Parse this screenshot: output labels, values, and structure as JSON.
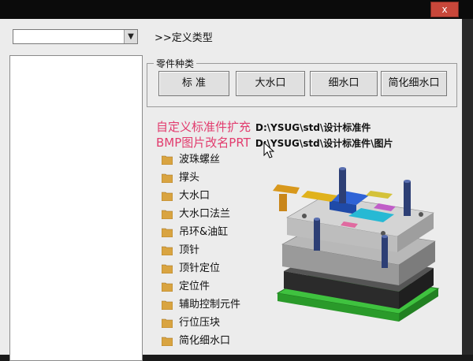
{
  "window": {
    "close_label": "x"
  },
  "left": {
    "combo_value": "",
    "dropdown_arrow": "▼"
  },
  "type_title": ">>定义类型",
  "group": {
    "label": "零件种类",
    "buttons": [
      "标 准",
      "大水口",
      "细水口",
      "简化细水口"
    ]
  },
  "info": {
    "line1_label": "自定义标准件扩充",
    "line1_path": "D:\\YSUG\\std\\设计标准件",
    "line2_label": "BMP图片改名PRT",
    "line2_path": "D:\\YSUG\\std\\设计标准件\\图片"
  },
  "items": [
    "波珠螺丝",
    "撑头",
    "大水口",
    "大水口法兰",
    "吊环&油缸",
    "顶针",
    "顶针定位",
    "定位件",
    "辅助控制元件",
    "行位压块",
    "简化细水口"
  ],
  "colors": {
    "accent_text": "#e23c6e",
    "folder": "#d9a441"
  },
  "icons": {
    "folder": "folder-icon",
    "cursor": "mouse-pointer-icon",
    "mold_image": "mold-base-3d-image"
  }
}
